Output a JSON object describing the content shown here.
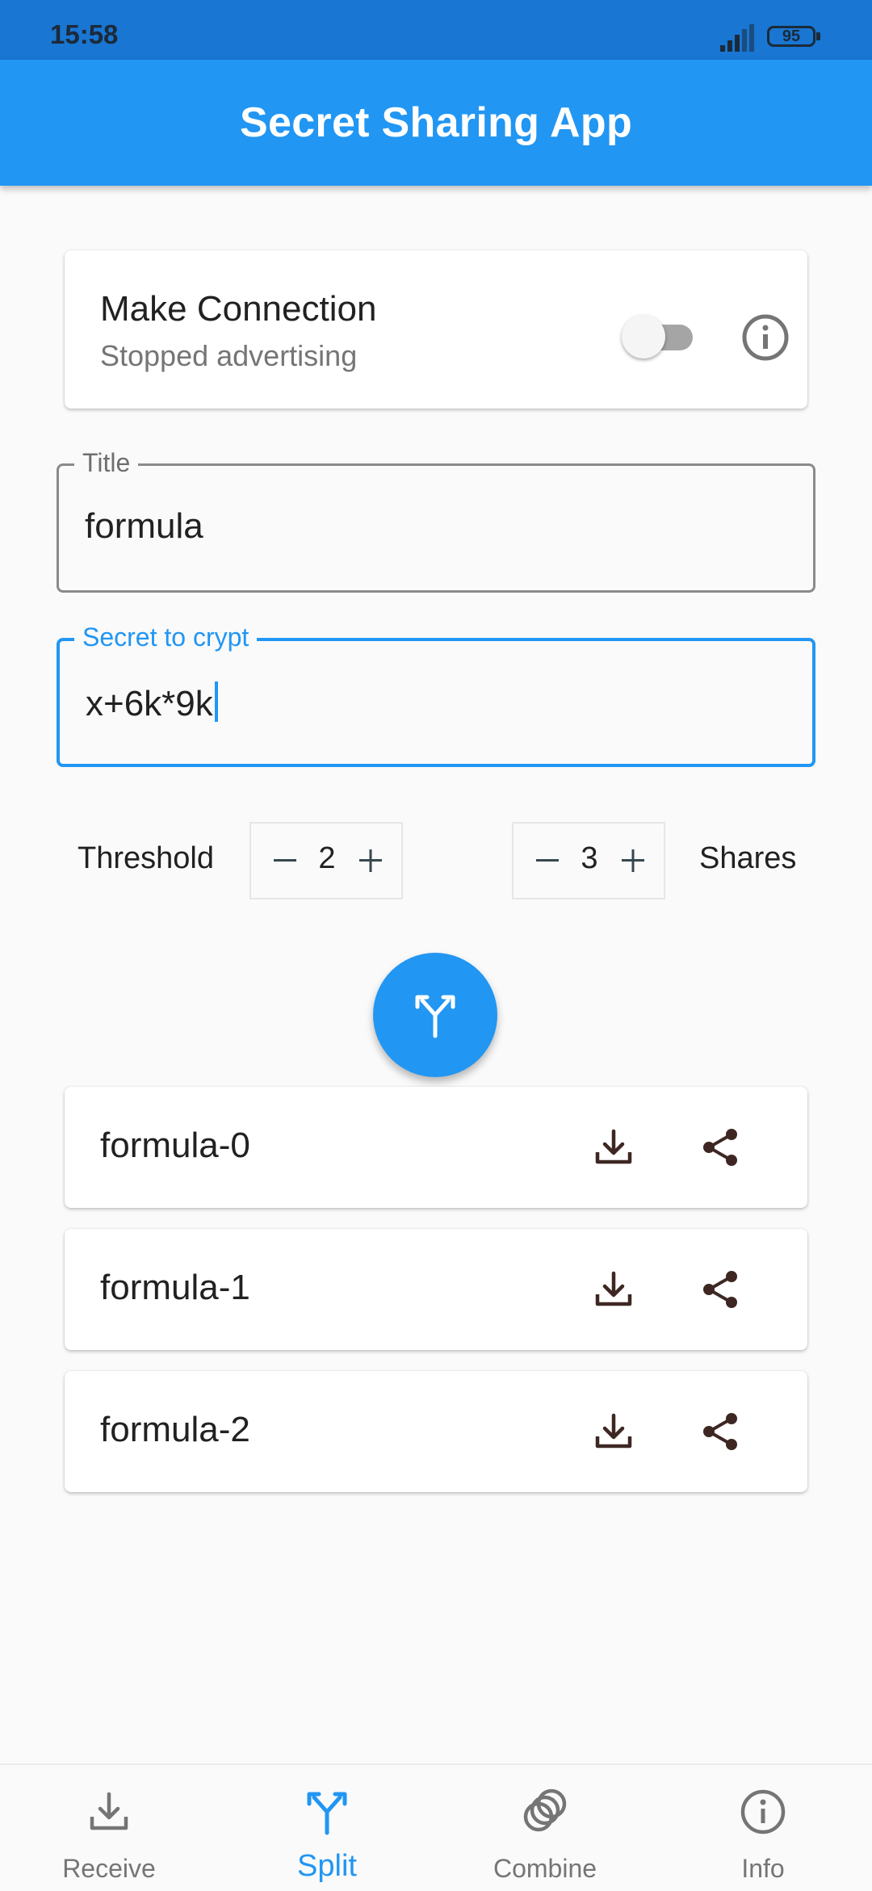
{
  "status_bar": {
    "time": "15:58",
    "battery": "95"
  },
  "app_bar": {
    "title": "Secret Sharing App"
  },
  "connection": {
    "title": "Make Connection",
    "subtitle": "Stopped advertising",
    "toggle_on": false
  },
  "title_field": {
    "label": "Title",
    "value": "formula"
  },
  "secret_field": {
    "label": "Secret to crypt",
    "value": "x+6k*9k"
  },
  "threshold": {
    "label": "Threshold",
    "value": "2"
  },
  "shares": {
    "label": "Shares",
    "value": "3"
  },
  "share_list": [
    {
      "name": "formula-0"
    },
    {
      "name": "formula-1"
    },
    {
      "name": "formula-2"
    }
  ],
  "bottom_nav": {
    "items": [
      {
        "label": "Receive",
        "icon": "download-icon"
      },
      {
        "label": "Split",
        "icon": "split-icon",
        "active": true
      },
      {
        "label": "Combine",
        "icon": "combine-icon"
      },
      {
        "label": "Info",
        "icon": "info-icon"
      }
    ]
  },
  "colors": {
    "primary": "#2196f3",
    "status_bar": "#1976d2",
    "icon_dark": "#3e2723",
    "inactive_text": "#757575"
  }
}
